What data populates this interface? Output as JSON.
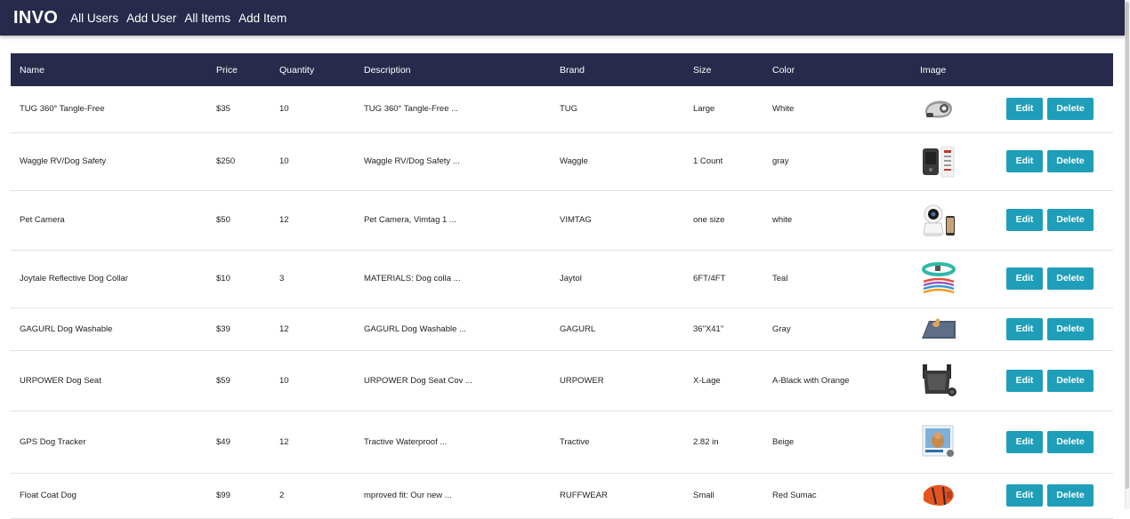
{
  "nav": {
    "brand": "INVO",
    "links": [
      "All Users",
      "Add User",
      "All Items",
      "Add Item"
    ]
  },
  "table": {
    "headers": [
      "Name",
      "Price",
      "Quantity",
      "Description",
      "Brand",
      "Size",
      "Color",
      "Image"
    ],
    "edit_label": "Edit",
    "delete_label": "Delete",
    "rows": [
      {
        "name": "TUG 360° Tangle-Free",
        "price": "$35",
        "quantity": "10",
        "description": "TUG 360° Tangle-Free ...",
        "brand": "TUG",
        "size": "Large",
        "color": "White",
        "image_icon": "leash-icon"
      },
      {
        "name": "Waggle RV/Dog Safety",
        "price": "$250",
        "quantity": "10",
        "description": "Waggle RV/Dog Safety ...",
        "brand": "Waggle",
        "size": "1 Count",
        "color": "gray",
        "image_icon": "temperature-monitor-icon"
      },
      {
        "name": "Pet Camera",
        "price": "$50",
        "quantity": "12",
        "description": "Pet Camera, Vimtag 1 ...",
        "brand": "VIMTAG",
        "size": "one size",
        "color": "white",
        "image_icon": "camera-icon"
      },
      {
        "name": "Joytale Reflective Dog Collar",
        "price": "$10",
        "quantity": "3",
        "description": "MATERIALS: Dog colla ...",
        "brand": "Jaytol",
        "size": "6FT/4FT",
        "color": "Teal",
        "image_icon": "collar-icon"
      },
      {
        "name": "GAGURL Dog Washable",
        "price": "$39",
        "quantity": "12",
        "description": "GAGURL Dog Washable ...",
        "brand": "GAGURL",
        "size": "36\"X41\"",
        "color": "Gray",
        "image_icon": "mat-icon"
      },
      {
        "name": "URPOWER Dog Seat",
        "price": "$59",
        "quantity": "10",
        "description": "URPOWER Dog Seat Cov ...",
        "brand": "URPOWER",
        "size": "X-Lage",
        "color": "A-Black with Orange",
        "image_icon": "seat-cover-icon"
      },
      {
        "name": "GPS Dog Tracker",
        "price": "$49",
        "quantity": "12",
        "description": "Tractive Waterproof ...",
        "brand": "Tractive",
        "size": "2.82 in",
        "color": "Beige",
        "image_icon": "tracker-box-icon"
      },
      {
        "name": "Float Coat Dog",
        "price": "$99",
        "quantity": "2",
        "description": "mproved fit: Our new ...",
        "brand": "RUFFWEAR",
        "size": "Small",
        "color": "Red Sumac",
        "image_icon": "life-jacket-icon"
      }
    ]
  },
  "colors": {
    "nav_bg": "#272a4b",
    "header_bg": "#272a4b",
    "button_bg": "#1f9eb9"
  }
}
